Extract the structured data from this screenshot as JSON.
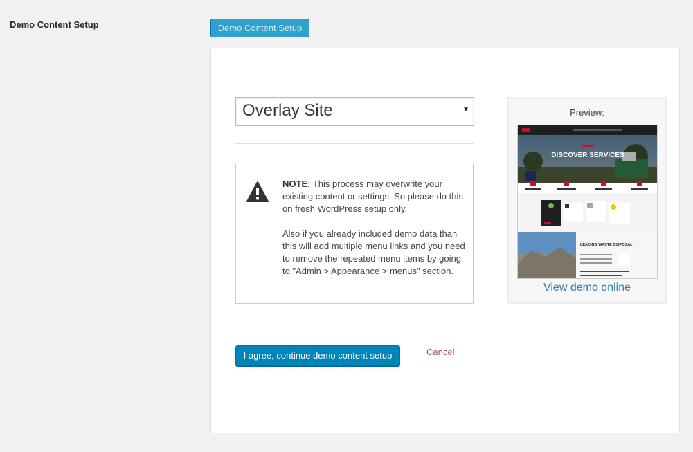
{
  "row": {
    "label": "Demo Content Setup"
  },
  "top_button": {
    "label": "Demo Content Setup"
  },
  "demo_select": {
    "value": "Overlay Site"
  },
  "note": {
    "label": "NOTE:",
    "text": "This process may overwrite your existing content or settings. So please do this on fresh WordPress setup only.",
    "text2": "Also if you already included demo data than this will add multiple menu links and you need to remove the repeated menu items by going to \"Admin > Appearance > menus\" section."
  },
  "preview": {
    "title": "Preview:",
    "view_link": "View demo online",
    "hero_text": "DISCOVER SERVICES",
    "section_text": "LEADING WASTE DISPOSAL"
  },
  "actions": {
    "agree_label": "I agree, continue demo content setup",
    "cancel_label": "Cancel"
  },
  "icons": {
    "warning": "warning-icon"
  },
  "colors": {
    "primary_button": "#0085ba",
    "top_button": "#2ea2cc",
    "link": "#2f7ab3",
    "cancel": "#a05a5a",
    "accent_red": "#c8102e"
  }
}
